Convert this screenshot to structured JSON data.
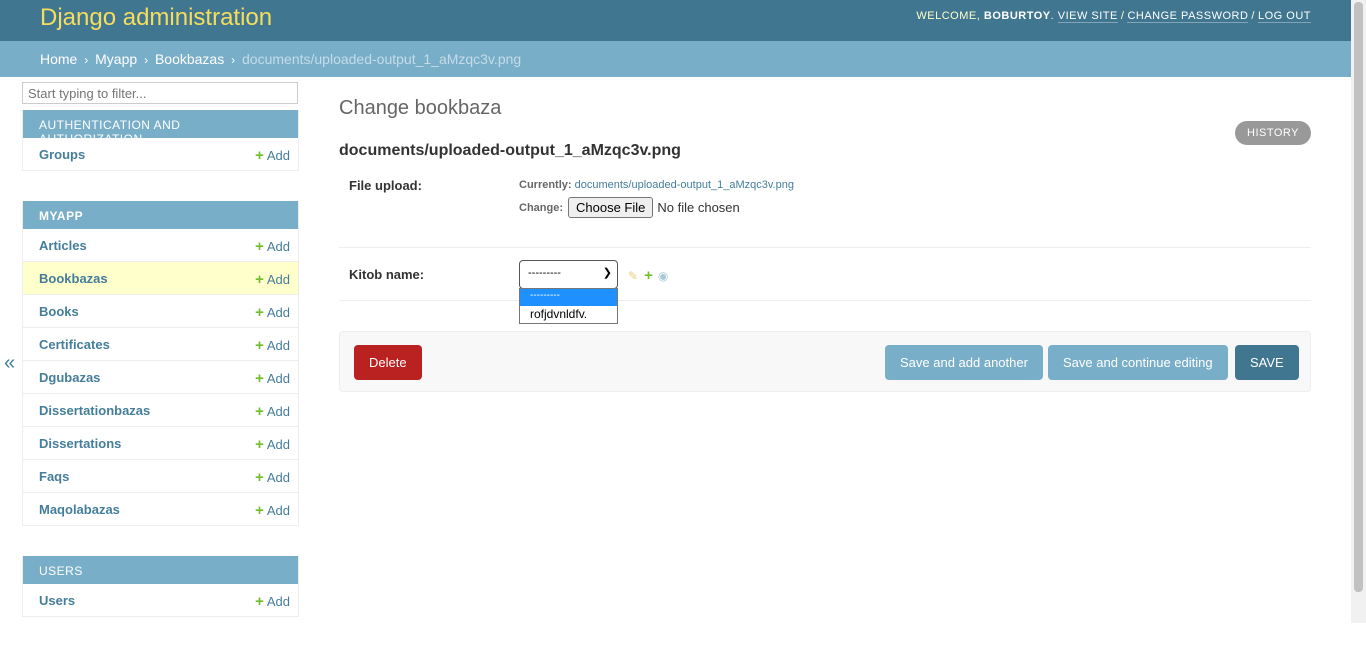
{
  "header": {
    "title": "Django administration",
    "welcome": "Welcome,",
    "username": "BOBURTOY",
    "view_site": "View site",
    "change_password": "Change password",
    "log_out": "Log out",
    "separator": "/"
  },
  "breadcrumbs": {
    "home": "Home",
    "app": "Myapp",
    "model": "Bookbazas",
    "current": "documents/uploaded-output_1_aMzqc3v.png",
    "arrow": "›"
  },
  "sidebar": {
    "filter_placeholder": "Start typing to filter...",
    "add_label": "Add",
    "toggle": "«",
    "modules": [
      {
        "caption": "Authentication and Authorization",
        "models": [
          "Groups"
        ]
      },
      {
        "caption": "Myapp",
        "models": [
          "Articles",
          "Bookbazas",
          "Books",
          "Certificates",
          "Dgubazas",
          "Dissertationbazas",
          "Dissertations",
          "Faqs",
          "Maqolabazas"
        ]
      },
      {
        "caption": "Users",
        "models": [
          "Users"
        ]
      }
    ]
  },
  "content": {
    "title": "Change bookbaza",
    "history": "History",
    "object_name": "documents/uploaded-output_1_aMzqc3v.png",
    "file_upload": {
      "label": "File upload:",
      "currently_label": "Currently:",
      "currently_link": "documents/uploaded-output_1_aMzqc3v.png",
      "change_label": "Change:",
      "choose_file": "Choose File",
      "no_file": "No file chosen"
    },
    "kitob": {
      "label": "Kitob name:",
      "selected": "---------",
      "options": [
        "---------",
        "rofjdvnldfv."
      ]
    }
  },
  "submit_row": {
    "delete": "Delete",
    "save_add_another": "Save and add another",
    "save_continue": "Save and continue editing",
    "save": "Save"
  },
  "colors": {
    "header_bg": "#417690",
    "branding": "#f5dd5d",
    "breadcrumbs_bg": "#79aec8",
    "link": "#447e9b",
    "delete": "#ba2121",
    "current_row": "#ffffcc",
    "add_plus": "#70bf2b"
  }
}
